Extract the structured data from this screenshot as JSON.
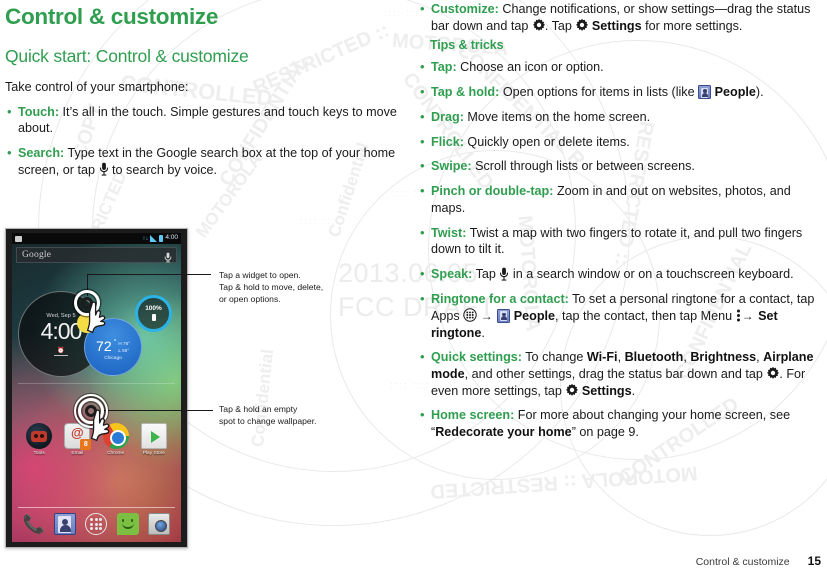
{
  "document": {
    "title": "Control & customize",
    "section_heading": "Quick start: Control & customize",
    "lead": "Take control of your smartphone:",
    "tips_heading": "Tips & tricks",
    "accent_color": "#2f9e4f"
  },
  "left_bullets": [
    {
      "term": "Touch:",
      "text": "It’s all in the touch. Simple gestures and touch keys to move about."
    },
    {
      "term": "Search:",
      "text_before": "Type text in the Google search box at the top of your home screen, or tap",
      "icon": "microphone-icon",
      "text_after": "to search by voice."
    }
  ],
  "right_bullets": [
    {
      "term": "Customize:",
      "text_a": "Change notifications, or show settings—drag the status bar down and tap",
      "icon_a": "gear-icon",
      "text_b": ". Tap",
      "icon_b": "gear-icon",
      "bold_b": "Settings",
      "text_c": "for more settings."
    },
    {
      "term": "Tap:",
      "text": "Choose an icon or option."
    },
    {
      "term": "Tap & hold:",
      "text_a": "Open options for items in lists (like",
      "icon_a": "people-icon",
      "bold_a": "People",
      "text_b": ")."
    },
    {
      "term": "Drag:",
      "text": "Move items on the home screen."
    },
    {
      "term": "Flick:",
      "text": "Quickly open or delete items."
    },
    {
      "term": "Swipe:",
      "text": "Scroll through lists or between screens."
    },
    {
      "term": "Pinch or double-tap:",
      "text": "Zoom in and out on websites, photos, and maps."
    },
    {
      "term": "Twist:",
      "text": "Twist a map with two fingers to rotate it, and pull two fingers down to tilt it."
    },
    {
      "term": "Speak:",
      "text_a": "Tap",
      "icon_a": "microphone-icon",
      "text_b": "in a search window or on a touchscreen keyboard."
    },
    {
      "term": "Ringtone for a contact:",
      "text_a": "To set a personal ringtone for a contact, tap Apps",
      "icon_a": "apps-grid-icon",
      "arrow_a": "→",
      "icon_b": "people-icon",
      "bold_b": "People",
      "text_b": ", tap the contact, then tap Menu",
      "icon_c": "menu-dots-icon",
      "arrow_b": "→",
      "bold_c": "Set ringtone",
      "text_c": "."
    },
    {
      "term": "Quick settings:",
      "text_a": "To change",
      "bold_a": "Wi-Fi",
      "sep_a": ",",
      "bold_b": "Bluetooth",
      "sep_b": ",",
      "bold_c": "Brightness",
      "sep_c": ",",
      "bold_d": "Airplane mode",
      "text_b": ", and other settings, drag the status bar down and tap",
      "icon_a": "gear-icon",
      "text_c": ". For even more settings, tap",
      "icon_b": "gear-icon",
      "bold_e": "Settings",
      "text_d": "."
    },
    {
      "term": "Home screen:",
      "text_a": "For more about changing your home screen, see “",
      "bold_a": "Redecorate your home",
      "text_b": "” on page 9."
    }
  ],
  "callouts": [
    {
      "name": "widget-callout",
      "line1": "Tap a widget to open.",
      "line2": "Tap & hold to move, delete,",
      "line3": "or open options."
    },
    {
      "name": "wallpaper-callout",
      "line1": "Tap & hold an empty",
      "line2": "spot to change wallpaper."
    }
  ],
  "phone": {
    "statusbar": {
      "time": "4:00",
      "message_icon": "message-icon",
      "sync_icon": "sync-icon",
      "signal_icon": "signal-icon",
      "battery_icon": "battery-icon"
    },
    "search": {
      "label": "Google",
      "mic_icon": "microphone-icon"
    },
    "clock_widget": {
      "date": "Wed, Sep 5",
      "time": "4:00",
      "alarm_icon": "alarm-icon"
    },
    "weather_widget": {
      "temp": "72",
      "degree": "°",
      "high": "H 76°",
      "low": "L 59°",
      "city": "Chicago"
    },
    "battery_widget": {
      "percent": "100%"
    },
    "apps": [
      {
        "label": "Tools",
        "icon": "tools-icon"
      },
      {
        "label": "Email",
        "icon": "email-icon",
        "badge": "8"
      },
      {
        "label": "Chrome",
        "icon": "chrome-icon"
      },
      {
        "label": "Play Store",
        "icon": "play-store-icon"
      }
    ],
    "dock": [
      {
        "icon": "phone-icon"
      },
      {
        "icon": "people-icon"
      },
      {
        "icon": "apps-grid-icon"
      },
      {
        "icon": "messaging-icon"
      },
      {
        "icon": "camera-icon"
      }
    ]
  },
  "footer": {
    "title": "Control & customize",
    "page": "15"
  },
  "watermark": {
    "date": "2013.06.05",
    "draft": "FCC DRAFT",
    "ring_text_1": "MOTOROLA CONFIDENTIAL RESTRICTED :: MOTOROLA",
    "ring_text_2": "Confidential Restricted"
  }
}
